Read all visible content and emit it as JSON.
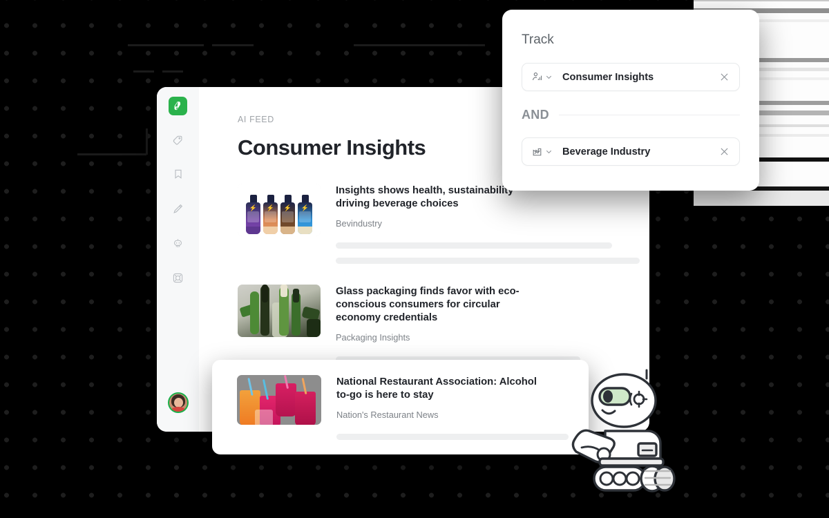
{
  "background": {
    "color": "#000000",
    "dot_color": "#1e1e1e"
  },
  "app": {
    "brand": "feedly",
    "sidebar": {
      "logo_name": "feedly-logo",
      "items": [
        {
          "name": "tag-icon",
          "label": "Tags"
        },
        {
          "name": "bookmark-icon",
          "label": "Read Later"
        },
        {
          "name": "pen-icon",
          "label": "Notes"
        },
        {
          "name": "robot-icon",
          "label": "Leo AI"
        },
        {
          "name": "lifebuoy-icon",
          "label": "Support"
        }
      ],
      "avatar_label": "User avatar",
      "accent_color": "#2bb24c"
    },
    "header": {
      "eyebrow": "AI FEED",
      "title": "Consumer Insights",
      "action_button": "feed-action-button"
    },
    "articles": [
      {
        "title": "Insights shows health, sustainability driving beverage choices",
        "source": "Bevindustry",
        "thumb": "cold-brew-bottles",
        "skeleton_widths": [
          "88%",
          "97%"
        ]
      },
      {
        "title": "Glass packaging finds favor with eco-conscious consumers for circular economy credentials",
        "source": "Packaging Insights",
        "thumb": "green-glass-bottles",
        "skeleton_widths": [
          "78%"
        ]
      },
      {
        "title": "National Restaurant Association: Alcohol to-go is here to stay",
        "source": "Nation's Restaurant News",
        "thumb": "colorful-drink-cups",
        "skeleton_widths": [
          "92%"
        ]
      }
    ]
  },
  "track_panel": {
    "title": "Track",
    "operator": "AND",
    "chips": [
      {
        "label": "Consumer Insights",
        "icon": "audience-chart-icon",
        "close": "remove-chip"
      },
      {
        "label": "Beverage Industry",
        "icon": "industry-chart-icon",
        "close": "remove-chip"
      }
    ]
  },
  "mascot": {
    "name": "leo-robot-mascot",
    "eye_color": "#cfe8c9"
  }
}
